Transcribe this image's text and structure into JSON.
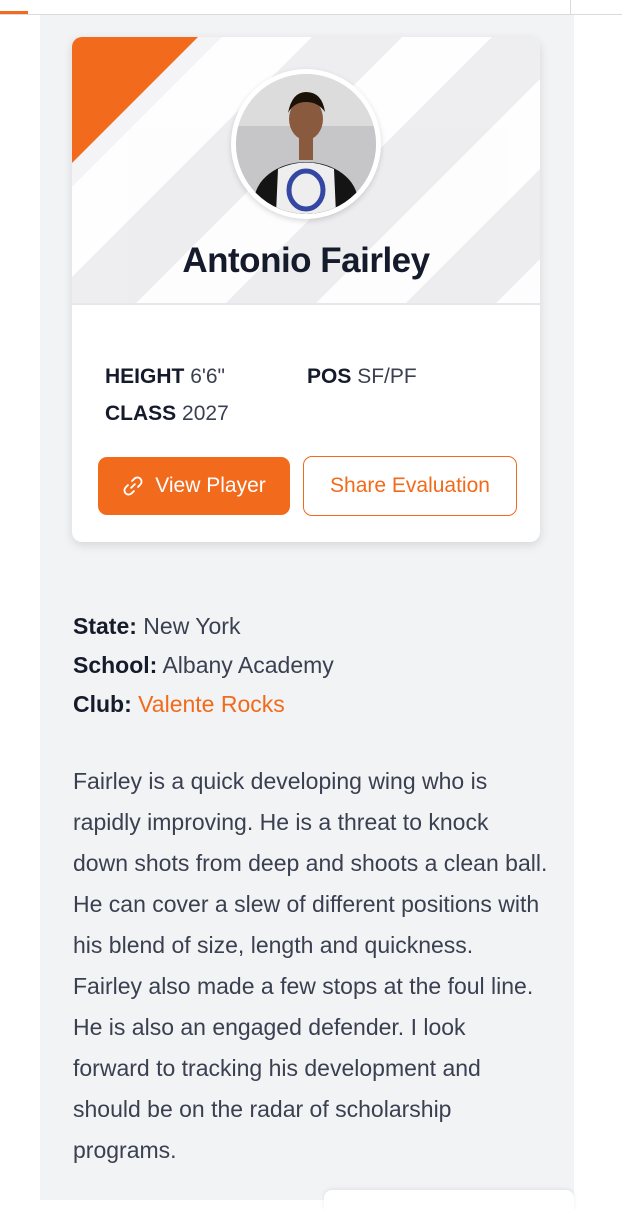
{
  "player": {
    "name": "Antonio Fairley",
    "height_label": "HEIGHT",
    "height_value": "6'6\"",
    "pos_label": "POS",
    "pos_value": "SF/PF",
    "class_label": "CLASS",
    "class_value": "2027"
  },
  "actions": {
    "view_player_label": "View Player",
    "view_player_icon": "link-icon",
    "share_label": "Share Evaluation"
  },
  "details": {
    "state_label": "State:",
    "state_value": "New York",
    "school_label": "School:",
    "school_value": "Albany Academy",
    "club_label": "Club:",
    "club_value": "Valente Rocks"
  },
  "evaluation": {
    "text": "Fairley is a quick developing wing who is rapidly improving. He is a threat to knock down shots from deep and shoots a clean ball. He can cover a slew of different positions with his blend of size, length and quickness. Fairley also made a few stops at the foul line. He is also an engaged defender. I look forward to tracking his development and should be on the radar of scholarship programs."
  },
  "colors": {
    "accent": "#f26a1b",
    "text_dark": "#161b2c",
    "text_body": "#3a4050",
    "page_bg": "#f2f3f5"
  }
}
